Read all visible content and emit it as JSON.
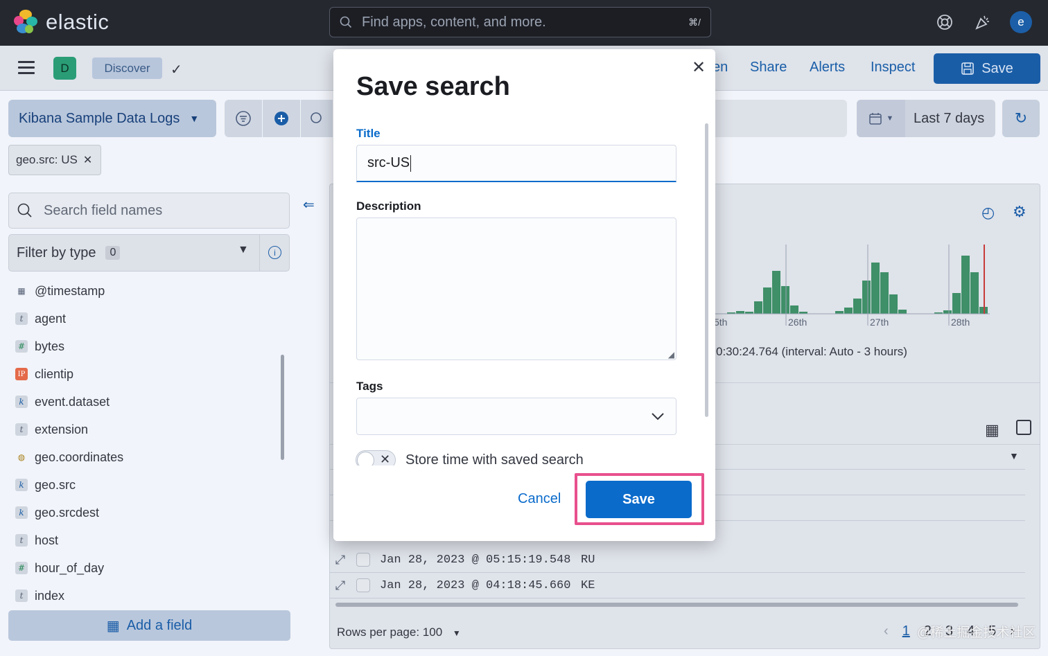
{
  "header": {
    "brand": "elastic",
    "search_placeholder": "Find apps, content, and more.",
    "search_shortcut": "⌘/",
    "avatar_initial": "e",
    "icons": [
      "help-icon",
      "newsfeed-icon"
    ]
  },
  "appbar": {
    "space_initial": "D",
    "breadcrumb": "Discover",
    "links": [
      "en",
      "Share",
      "Alerts",
      "Inspect"
    ],
    "save_label": "Save"
  },
  "query_bar": {
    "data_view": "Kibana Sample Data Logs",
    "time_range": "Last 7 days",
    "filter_pill": "geo.src: US"
  },
  "sidebar": {
    "search_placeholder": "Search field names",
    "filter_label": "Filter by type",
    "filter_count": "0",
    "fields": [
      {
        "name": "@timestamp",
        "type": "date"
      },
      {
        "name": "agent",
        "type": "t"
      },
      {
        "name": "bytes",
        "type": "#"
      },
      {
        "name": "clientip",
        "type": "IP"
      },
      {
        "name": "event.dataset",
        "type": "k"
      },
      {
        "name": "extension",
        "type": "t"
      },
      {
        "name": "geo.coordinates",
        "type": "geo"
      },
      {
        "name": "geo.src",
        "type": "k"
      },
      {
        "name": "geo.srcdest",
        "type": "k"
      },
      {
        "name": "host",
        "type": "t"
      },
      {
        "name": "hour_of_day",
        "type": "#"
      },
      {
        "name": "index",
        "type": "t"
      }
    ],
    "add_field_label": "Add a field"
  },
  "main": {
    "histogram_ticks": [
      "5th",
      "26th",
      "27th",
      "28th"
    ],
    "interval_text": "0:30:24.764 (interval: Auto - 3 hours)",
    "rows": [
      {
        "timestamp": "Jan 28, 2023 @ 05:15:19.548",
        "geo": "RU"
      },
      {
        "timestamp": "Jan 28, 2023 @ 04:18:45.660",
        "geo": "KE"
      }
    ],
    "rows_per_page": "Rows per page: 100",
    "pages": [
      "1",
      "2",
      "3",
      "4",
      "5"
    ]
  },
  "modal": {
    "title": "Save search",
    "title_label": "Title",
    "title_value": "src-US",
    "description_label": "Description",
    "tags_label": "Tags",
    "toggle_label": "Store time with saved search",
    "cancel_label": "Cancel",
    "save_label": "Save"
  },
  "watermark": "@稀土掘金技术社区",
  "colors": {
    "accent": "#0a6bcb",
    "highlight": "#e8508d",
    "histogram_bar": "#3f8f68",
    "header_bg": "#25282f"
  }
}
